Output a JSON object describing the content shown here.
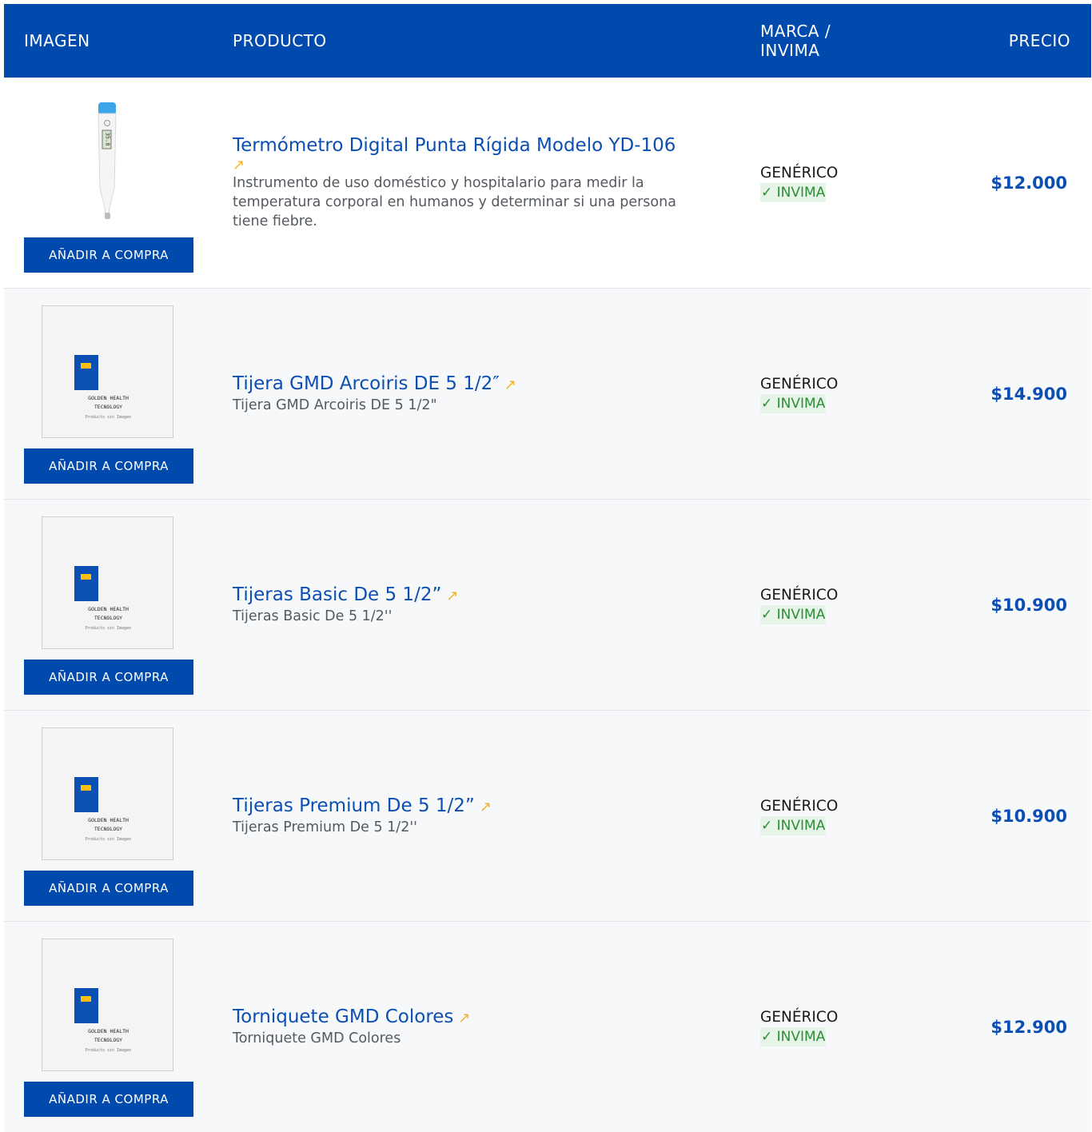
{
  "header": {
    "col_image": "IMAGEN",
    "col_product": "PRODUCTO",
    "col_brand": "MARCA / INVIMA",
    "col_price": "PRECIO"
  },
  "add_button_label": "AÑADIR A COMPRA",
  "placeholder": {
    "brand_line1": "GOLDEN HEALTH",
    "brand_line2": "TECNOLOGY",
    "note": "Producto sin Imagen"
  },
  "products": [
    {
      "title": "Termómetro Digital Punta Rígida Modelo YD-106",
      "link_icon": "arrow-up-right-icon",
      "description": "Instrumento de uso doméstico y hospitalario para medir la temperatura corporal en humanos y determinar si una persona tiene fiebre.",
      "brand": "GENÉRICO",
      "invima": "✓ INVIMA",
      "price": "$12.000",
      "thermo_reading": "35.8",
      "image": "thermometer-photo"
    },
    {
      "title": "Tijera GMD Arcoiris DE 5 1/2″",
      "link_icon": "arrow-up-right-icon",
      "description": "Tijera GMD Arcoiris DE 5 1/2\"",
      "brand": "GENÉRICO",
      "invima": "✓ INVIMA",
      "price": "$14.900",
      "image": "no-image-placeholder"
    },
    {
      "title": "Tijeras Basic De 5 1/2”",
      "link_icon": "arrow-up-right-icon",
      "description": "Tijeras Basic De 5 1/2''",
      "brand": "GENÉRICO",
      "invima": "✓ INVIMA",
      "price": "$10.900",
      "image": "no-image-placeholder"
    },
    {
      "title": "Tijeras Premium De 5 1/2”",
      "link_icon": "arrow-up-right-icon",
      "description": "Tijeras Premium De 5 1/2''",
      "brand": "GENÉRICO",
      "invima": "✓ INVIMA",
      "price": "$10.900",
      "image": "no-image-placeholder"
    },
    {
      "title": "Torniquete GMD Colores",
      "link_icon": "arrow-up-right-icon",
      "description": "Torniquete GMD Colores",
      "brand": "GENÉRICO",
      "invima": "✓ INVIMA",
      "price": "$12.900",
      "image": "no-image-placeholder"
    }
  ],
  "colors": {
    "primary": "#004aad",
    "title_link": "#0b4fb3",
    "arrow": "#f0b429",
    "invima_text": "#2e8b3a",
    "invima_bg": "#e6f4e8"
  }
}
